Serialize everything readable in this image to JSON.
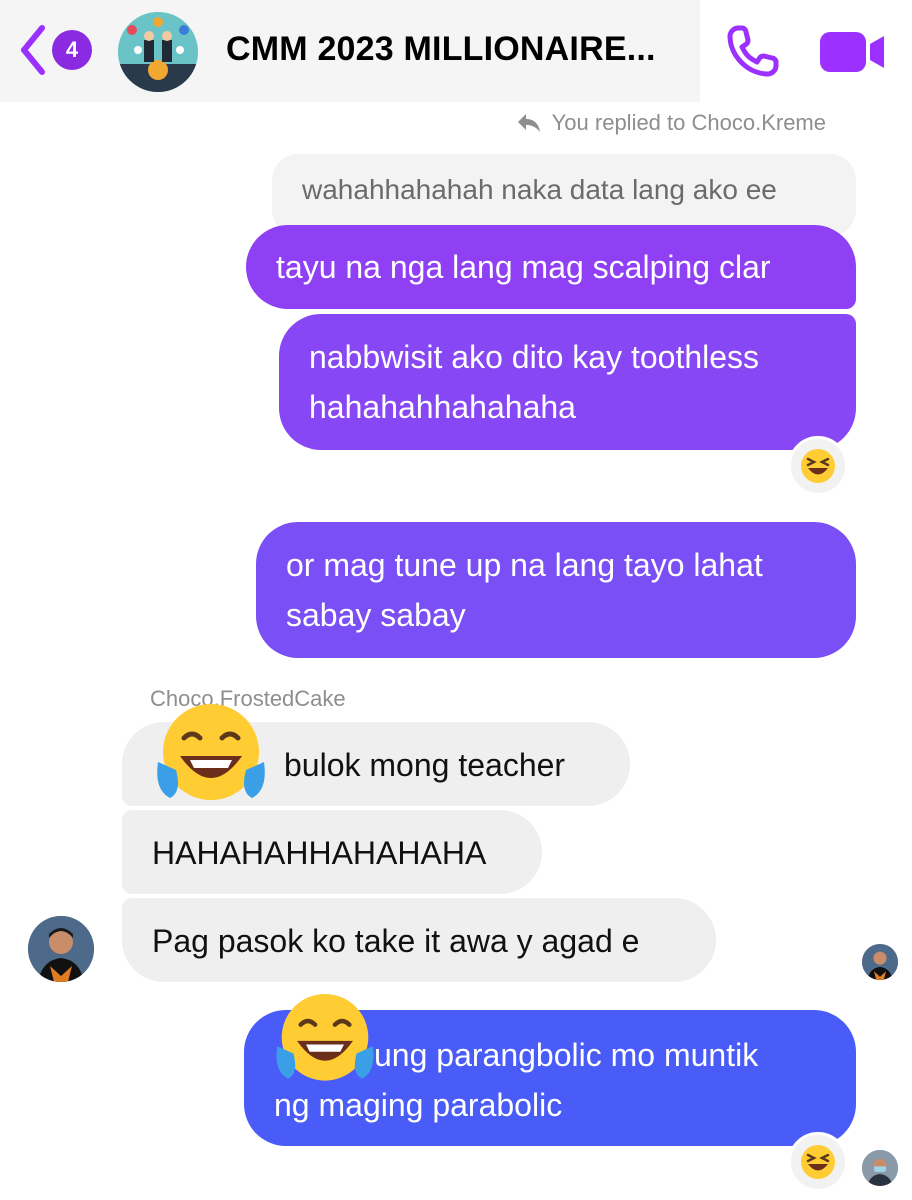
{
  "header": {
    "back_count": "4",
    "title": "CMM 2023 MILLIONAIRE...",
    "icons": {
      "back": "chevron-left-icon",
      "call": "phone-icon",
      "video": "video-camera-icon"
    },
    "accent_color": "#9b30ff"
  },
  "messages": {
    "reply_note": "You replied to Choco.Kreme",
    "quoted_text": "wahahhahahah naka data lang ako ee",
    "outgoing_1": "tayu na nga lang mag scalping clar",
    "outgoing_2_line1": "nabbwisit ako dito kay toothless",
    "outgoing_2_line2": "hahahahhahahaha",
    "outgoing_3_line1": "or mag tune up na lang tayo lahat",
    "outgoing_3_line2": "sabay sabay",
    "sender_name": "Choco.FrostedCake",
    "incoming_1": "bulok mong teacher",
    "incoming_2": "HAHAHAHHAHAHAHA",
    "incoming_3": "Pag pasok ko take it awa y agad e",
    "outgoing_4_line1": "ung parangbolic mo muntik",
    "outgoing_4_line2": "ng maging parabolic",
    "reaction_emoji": "laughing-squint-emoji",
    "big_emoji": "tears-of-joy-emoji"
  }
}
